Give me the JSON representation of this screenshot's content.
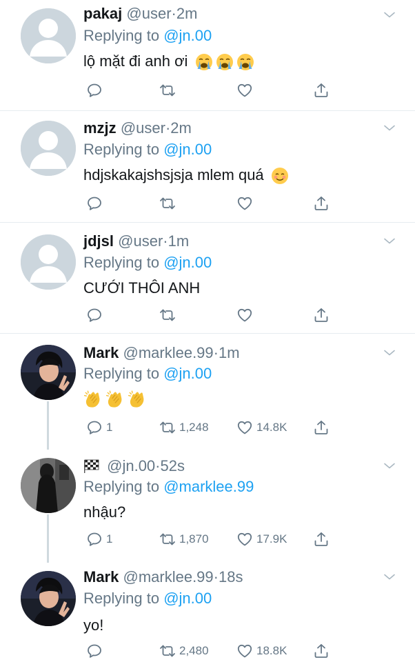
{
  "tweets": [
    {
      "name": "pakaj",
      "handle": "@user",
      "dot": "·",
      "time": "2m",
      "replying": "Replying to",
      "mention": "@jn.00",
      "text": "lộ mặt đi anh ơi",
      "emoji": "loudly-crying-face x3",
      "replies": "",
      "retweets": "",
      "likes": ""
    },
    {
      "name": "mzjz",
      "handle": "@user",
      "dot": "·",
      "time": "2m",
      "replying": "Replying to",
      "mention": "@jn.00",
      "text": "hdjskakajshsjsja mlem quá",
      "emoji": "smiling-face",
      "replies": "",
      "retweets": "",
      "likes": ""
    },
    {
      "name": "jdjsl",
      "handle": "@user",
      "dot": "·",
      "time": "1m",
      "replying": "Replying to",
      "mention": "@jn.00",
      "text": "CƯỚI THÔI ANH",
      "emoji": "",
      "replies": "",
      "retweets": "",
      "likes": ""
    },
    {
      "name": "Mark",
      "handle": "@marklee.99",
      "dot": "·",
      "time": "1m",
      "replying": "Replying to",
      "mention": "@jn.00",
      "text": "",
      "emoji": "clapping-hands x3",
      "replies": "1",
      "retweets": "1,248",
      "likes": "14.8K"
    },
    {
      "name": "",
      "handle": "@jn.00",
      "dot": "·",
      "time": "52s",
      "replying": "Replying to",
      "mention": "@marklee.99",
      "text": "nhậu?",
      "emoji": "checkered-flag",
      "replies": "1",
      "retweets": "1,870",
      "likes": "17.9K"
    },
    {
      "name": "Mark",
      "handle": "@marklee.99",
      "dot": "·",
      "time": "18s",
      "replying": "Replying to",
      "mention": "@jn.00",
      "text": "yo!",
      "emoji": "",
      "replies": "",
      "retweets": "2,480",
      "likes": "18.8K"
    }
  ],
  "icons": {
    "reply": "reply-icon",
    "retweet": "retweet-icon",
    "like": "heart-icon",
    "share": "share-icon",
    "more": "chevron-down-icon"
  },
  "colors": {
    "link": "#1da1f2",
    "muted": "#657786",
    "text": "#14171a",
    "separator": "#e6ecf0"
  }
}
